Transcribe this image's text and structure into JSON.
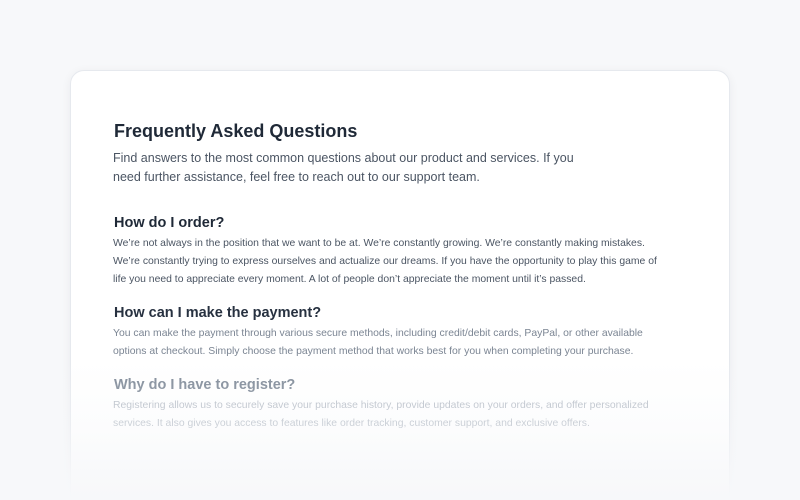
{
  "faq": {
    "title": "Frequently Asked Questions",
    "description": "Find answers to the most common questions about our product and services. If you need further assistance, feel free to reach out to our support team.",
    "items": [
      {
        "question": "How do I order?",
        "answer": "We’re not always in the position that we want to be at. We’re constantly growing. We’re constantly making mistakes. We’re constantly trying to express ourselves and actualize our dreams. If you have the opportunity to play this game of life you need to appreciate every moment. A lot of people don’t appreciate the moment until it’s passed."
      },
      {
        "question": "How can I make the payment?",
        "answer": "You can make the payment through various secure methods, including credit/debit cards, PayPal, or other available options at checkout. Simply choose the payment method that works best for you when completing your purchase."
      },
      {
        "question": "Why do I have to register?",
        "answer": "Registering allows us to securely save your purchase history, provide updates on your orders, and offer personalized services. It also gives you access to features like order tracking, customer support, and exclusive offers."
      }
    ]
  }
}
